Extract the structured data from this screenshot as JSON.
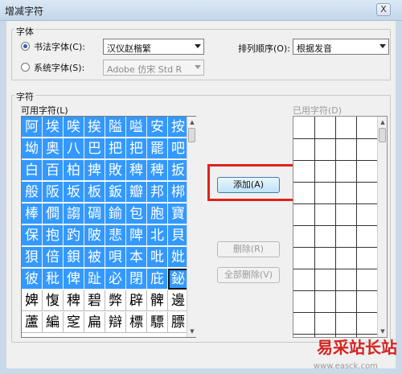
{
  "window": {
    "title": "增减字符",
    "close_label": "X"
  },
  "font_group": {
    "label": "字体",
    "calligraphy_radio": "书法字体(C):",
    "calligraphy_value": "汉仪赵楷繁",
    "system_radio": "系统字体(S):",
    "system_value": "Adobe 仿宋 Std R",
    "sort_label": "排列顺序(O):",
    "sort_value": "根据发音"
  },
  "chars_group": {
    "label": "字符",
    "available_label": "可用字符(L)",
    "used_label": "已用字符(D)",
    "available_chars": [
      [
        "阿",
        "埃",
        "唉",
        "挨",
        "隘",
        "嗌",
        "安",
        "按"
      ],
      [
        "坳",
        "奥",
        "八",
        "巴",
        "把",
        "把",
        "罷",
        "吧"
      ],
      [
        "白",
        "百",
        "柏",
        "捭",
        "敗",
        "稗",
        "稗",
        "扳"
      ],
      [
        "般",
        "阪",
        "坂",
        "板",
        "鈑",
        "瓣",
        "邦",
        "梆"
      ],
      [
        "棒",
        "僴",
        "謅",
        "碉",
        "鍮",
        "包",
        "胞",
        "寶"
      ],
      [
        "保",
        "抱",
        "趵",
        "陂",
        "悲",
        "陴",
        "北",
        "貝"
      ],
      [
        "狽",
        "倍",
        "鋇",
        "被",
        "唄",
        "本",
        "吡",
        "妣"
      ],
      [
        "彼",
        "秕",
        "俾",
        "趾",
        "必",
        "閉",
        "庇",
        "鉍"
      ],
      [
        "婢",
        "愎",
        "稗",
        "碧",
        "弊",
        "辟",
        "髀",
        "邊"
      ],
      [
        "蘆",
        "編",
        "窆",
        "扁",
        "辯",
        "標",
        "驃",
        "膘"
      ]
    ],
    "selected_rows": 8
  },
  "buttons": {
    "add": "添加(A)",
    "delete": "删除(R)",
    "delete_all": "全部删除(V)"
  },
  "watermark": {
    "text": "易采站长站",
    "url": "www.easck.com"
  }
}
